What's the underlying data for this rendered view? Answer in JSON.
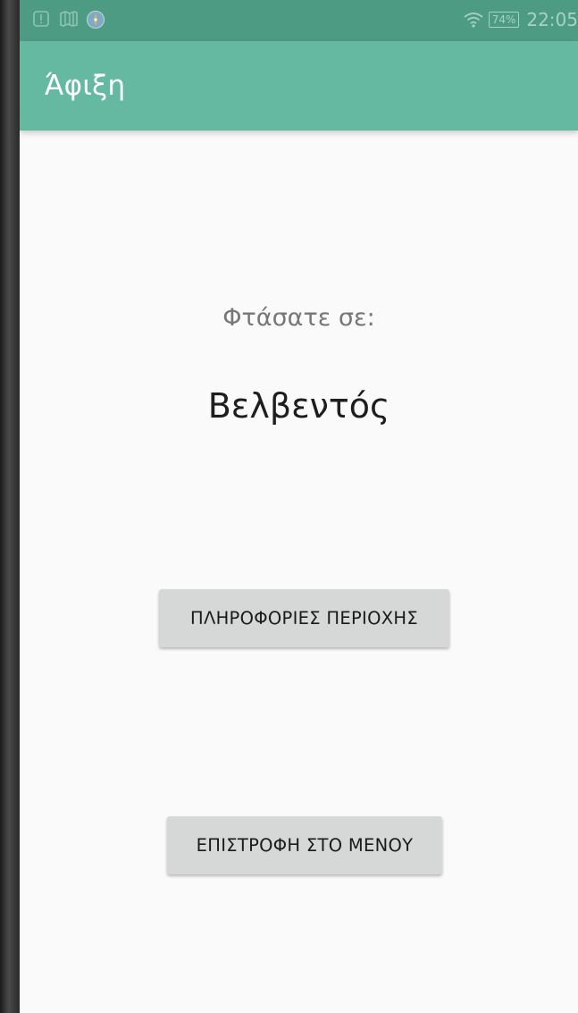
{
  "status_bar": {
    "icons": [
      "alert-icon",
      "map-icon",
      "compass-icon",
      "wifi-icon"
    ],
    "battery": "74%",
    "time": "22:05"
  },
  "app_bar": {
    "title": "Άφιξη"
  },
  "main": {
    "arrived_label": "Φτάσατε σε:",
    "destination": "Βελβεντός",
    "info_button_label": "ΠΛΗΡΟΦΟΡΙΕΣ ΠΕΡΙΟΧΗΣ",
    "back_button_label": "ΕΠΙΣΤΡΟΦΗ ΣΤΟ ΜΕΝΟΥ"
  },
  "colors": {
    "status_bar": "#4e9b84",
    "app_bar": "#64b9a0",
    "background": "#fafafa",
    "button": "#d6d7d7"
  }
}
